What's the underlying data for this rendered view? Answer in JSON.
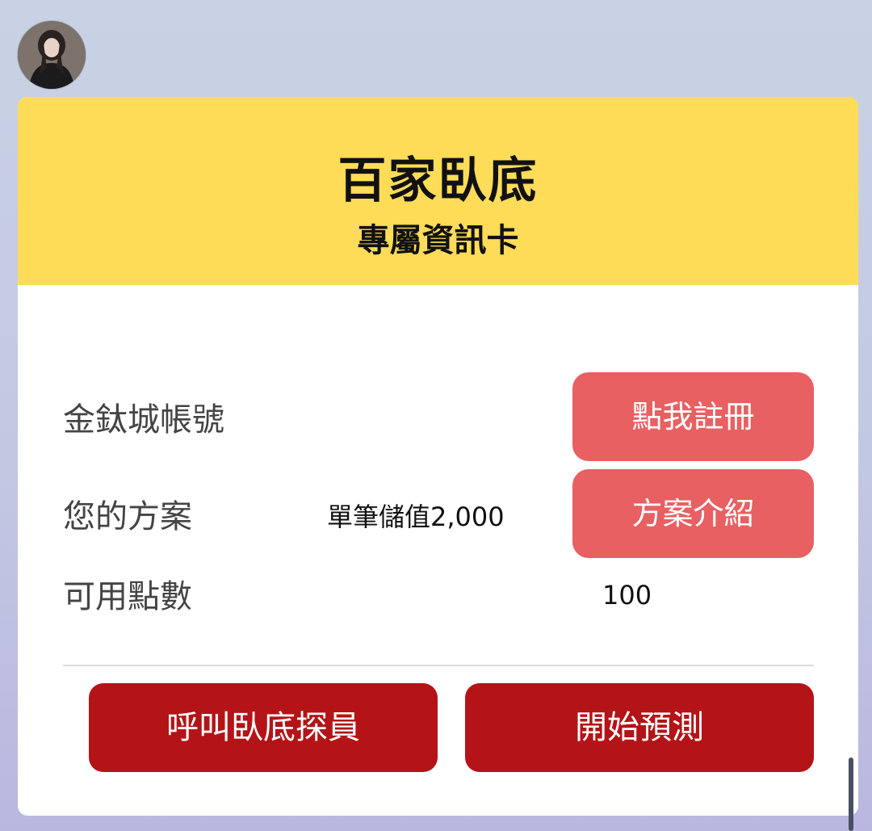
{
  "card": {
    "title": "百家臥底",
    "subtitle": "專屬資訊卡"
  },
  "rows": {
    "account": {
      "label": "金鈦城帳號",
      "value": "",
      "button_label": "點我註冊"
    },
    "plan": {
      "label": "您的方案",
      "value": "單筆儲值2,000",
      "button_label": "方案介紹"
    },
    "points": {
      "label": "可用點數",
      "value": "100"
    }
  },
  "actions": {
    "call_agent_label": "呼叫臥底探員",
    "start_prediction_label": "開始預測"
  },
  "colors": {
    "header_background": "#ffdc58",
    "pill_button": "#e86062",
    "action_button": "#b41417",
    "page_background": "#c6cce3"
  },
  "icons": {
    "avatar": "user-avatar-photo"
  }
}
